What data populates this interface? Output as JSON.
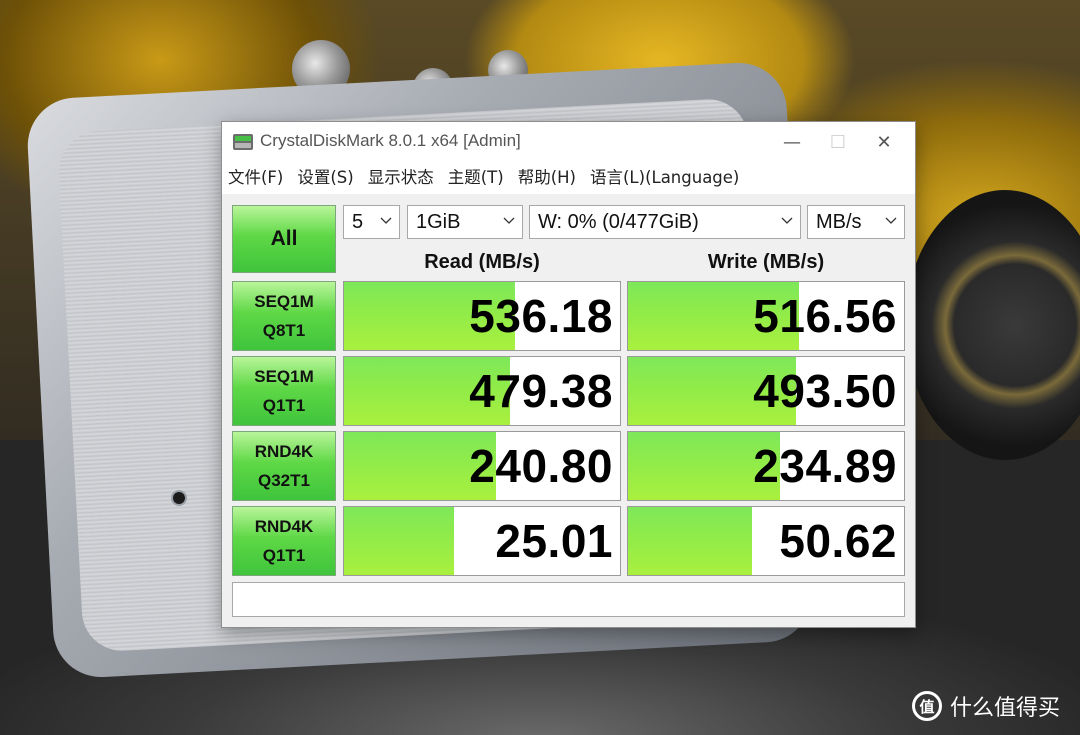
{
  "window": {
    "title": "CrystalDiskMark 8.0.1 x64 [Admin]",
    "icon": "crystaldiskmark-icon",
    "controls": {
      "minimize": "—",
      "maximize": "☐",
      "close": "✕"
    }
  },
  "menu": [
    "文件(F)",
    "设置(S)",
    "显示状态",
    "主题(T)",
    "帮助(H)",
    "语言(L)(Language)"
  ],
  "controls": {
    "all_label": "All",
    "count": "5",
    "size": "1GiB",
    "drive": "W: 0% (0/477GiB)",
    "unit": "MB/s"
  },
  "headers": {
    "read": "Read (MB/s)",
    "write": "Write (MB/s)"
  },
  "tests": [
    {
      "line1": "SEQ1M",
      "line2": "Q8T1",
      "read": "536.18",
      "write": "516.56",
      "read_fill": 0.62,
      "write_fill": 0.62
    },
    {
      "line1": "SEQ1M",
      "line2": "Q1T1",
      "read": "479.38",
      "write": "493.50",
      "read_fill": 0.6,
      "write_fill": 0.61
    },
    {
      "line1": "RND4K",
      "line2": "Q32T1",
      "read": "240.80",
      "write": "234.89",
      "read_fill": 0.55,
      "write_fill": 0.55
    },
    {
      "line1": "RND4K",
      "line2": "Q1T1",
      "read": "25.01",
      "write": "50.62",
      "read_fill": 0.4,
      "write_fill": 0.45
    }
  ],
  "status_text": "",
  "colors": {
    "bar": "#8eeb4a",
    "button": "#5fd846"
  },
  "watermark": {
    "logo_text": "值",
    "text": "什么值得买"
  }
}
